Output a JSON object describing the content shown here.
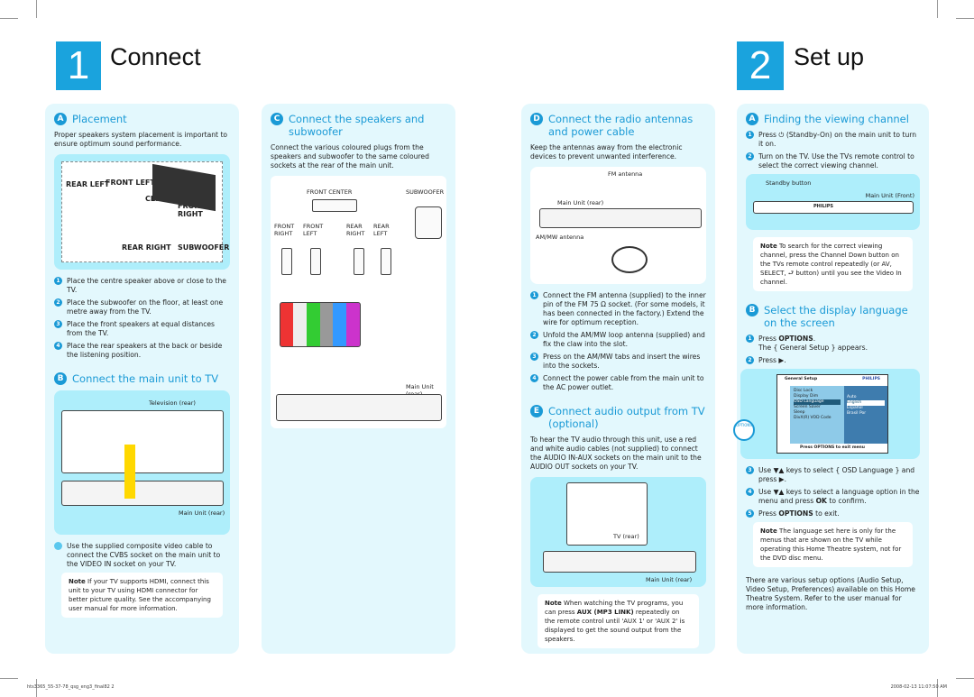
{
  "section1": {
    "number": "1",
    "title": "Connect"
  },
  "section2": {
    "number": "2",
    "title": "Set up"
  },
  "placement": {
    "badge": "A",
    "title": "Placement",
    "intro": "Proper speakers system placement is important to ensure optimum sound performance.",
    "figure_labels": [
      "REAR LEFT",
      "FRONT LEFT",
      "CENTER",
      "FRONT RIGHT",
      "REAR RIGHT",
      "SUBWOOFER"
    ],
    "steps": [
      "Place the centre speaker above or close to the TV.",
      "Place the subwoofer on the floor, at least one metre away from the TV.",
      "Place the front speakers at equal distances from the TV.",
      "Place the rear speakers at the back or beside the listening position."
    ]
  },
  "main_to_tv": {
    "badge": "B",
    "title": "Connect the main unit to TV",
    "tv_label": "Television (rear)",
    "unit_label": "Main Unit (rear)",
    "step": "Use the supplied composite video cable to connect the CVBS socket on the main unit to the VIDEO IN socket on your TV.",
    "note_label": "Note",
    "note": "If your TV supports HDMI, connect this unit to your TV using HDMI connector for better picture quality. See the accompanying user manual for more information."
  },
  "speakers": {
    "badge": "C",
    "title": "Connect the speakers and subwoofer",
    "intro": "Connect the various coloured plugs from the speakers and subwoofer to the same coloured sockets at the rear of the main unit.",
    "labels": {
      "front_center": "FRONT CENTER",
      "subwoofer": "SUBWOOFER",
      "front_right": "FRONT RIGHT",
      "front_left": "FRONT LEFT",
      "rear_right": "REAR RIGHT",
      "rear_left": "REAR LEFT",
      "unit": "Main Unit (rear)"
    }
  },
  "antennas": {
    "badge": "D",
    "title": "Connect the radio antennas and power cable",
    "intro": "Keep the antennas away from the electronic devices to prevent unwanted interference.",
    "labels": {
      "fm": "FM antenna",
      "unit": "Main Unit (rear)",
      "am": "AM/MW antenna"
    },
    "steps": [
      "Connect the FM antenna (supplied) to the inner pin of the FM 75 Ω socket. (For some models, it has been connected in the factory.) Extend the wire for optimum reception.",
      "Unfold the AM/MW loop antenna (supplied) and fix the claw into the slot.",
      "Press on the AM/MW tabs and insert the wires into the sockets.",
      "Connect the power cable from the main unit to the AC power outlet."
    ]
  },
  "audio_out": {
    "badge": "E",
    "title": "Connect audio output from TV (optional)",
    "intro": "To hear the TV audio through this unit, use a red and white audio cables (not supplied) to connect the AUDIO IN-AUX sockets on the main unit to the AUDIO OUT sockets on your TV.",
    "tv_label": "TV (rear)",
    "unit_label": "Main Unit (rear)",
    "note_label": "Note",
    "note_pre": "When watching the TV programs, you can press ",
    "note_bold": "AUX (MP3 LINK)",
    "note_post": " repeatedly on the remote control until 'AUX 1' or 'AUX 2' is displayed to get the sound output from the speakers."
  },
  "viewing": {
    "badge": "A",
    "title": "Finding the viewing channel",
    "steps": [
      "Press ⏻ (Standby-On) on the main unit to turn it on.",
      "Turn on the TV. Use the TVs remote control to select the correct viewing channel."
    ],
    "standby_label": "Standby button",
    "unit_label": "Main Unit (Front)",
    "brand": "PHILIPS",
    "note_label": "Note",
    "note": "To search for the correct viewing channel, press the Channel Down button on the TVs remote control repeatedly (or AV, SELECT, ⮐ button) until you see the Video In channel."
  },
  "language": {
    "badge": "B",
    "title": "Select the display language on the screen",
    "step1_pre": "Press ",
    "step1_bold": "OPTIONS",
    "step1_post": ".",
    "step1_sub": "The { General Setup } appears.",
    "step2": "Press ▶.",
    "menu": {
      "title": "General Setup",
      "brand": "PHILIPS",
      "items": [
        "Disc Lock",
        "Display Dim",
        "OSD Language",
        "Screen Saver",
        "Sleep",
        "DivX(R) VOD Code"
      ],
      "selected": "OSD Language",
      "options": [
        "Auto",
        "English",
        "Español",
        "Brasil Por"
      ],
      "checked": "English",
      "footer": "Press OPTIONS to exit menu"
    },
    "remote_button": "OPTIONS",
    "step3": "Use ▼▲ keys to select { OSD Language } and press ▶.",
    "step4_pre": "Use ▼▲ keys to select a language option in the menu and press ",
    "step4_bold": "OK",
    "step4_post": " to confirm.",
    "step5_pre": "Press ",
    "step5_bold": "OPTIONS",
    "step5_post": " to exit.",
    "note_label": "Note",
    "note": "The language set here is only for the menus that are shown on the TV while operating this Home Theatre system, not for the DVD disc menu.",
    "outro": "There are various setup options (Audio Setup, Video Setup, Preferences) available on this Home Theatre System. Refer to the user manual for more information."
  },
  "footer": {
    "left": "hts3365_55-37-78_qsg_eng3_final82  2",
    "right": "2008-02-13  11:07:50 AM"
  },
  "colors": {
    "accent": "#1aa3dd",
    "panel": "#e3f8fd",
    "figure": "#aeeefb"
  }
}
